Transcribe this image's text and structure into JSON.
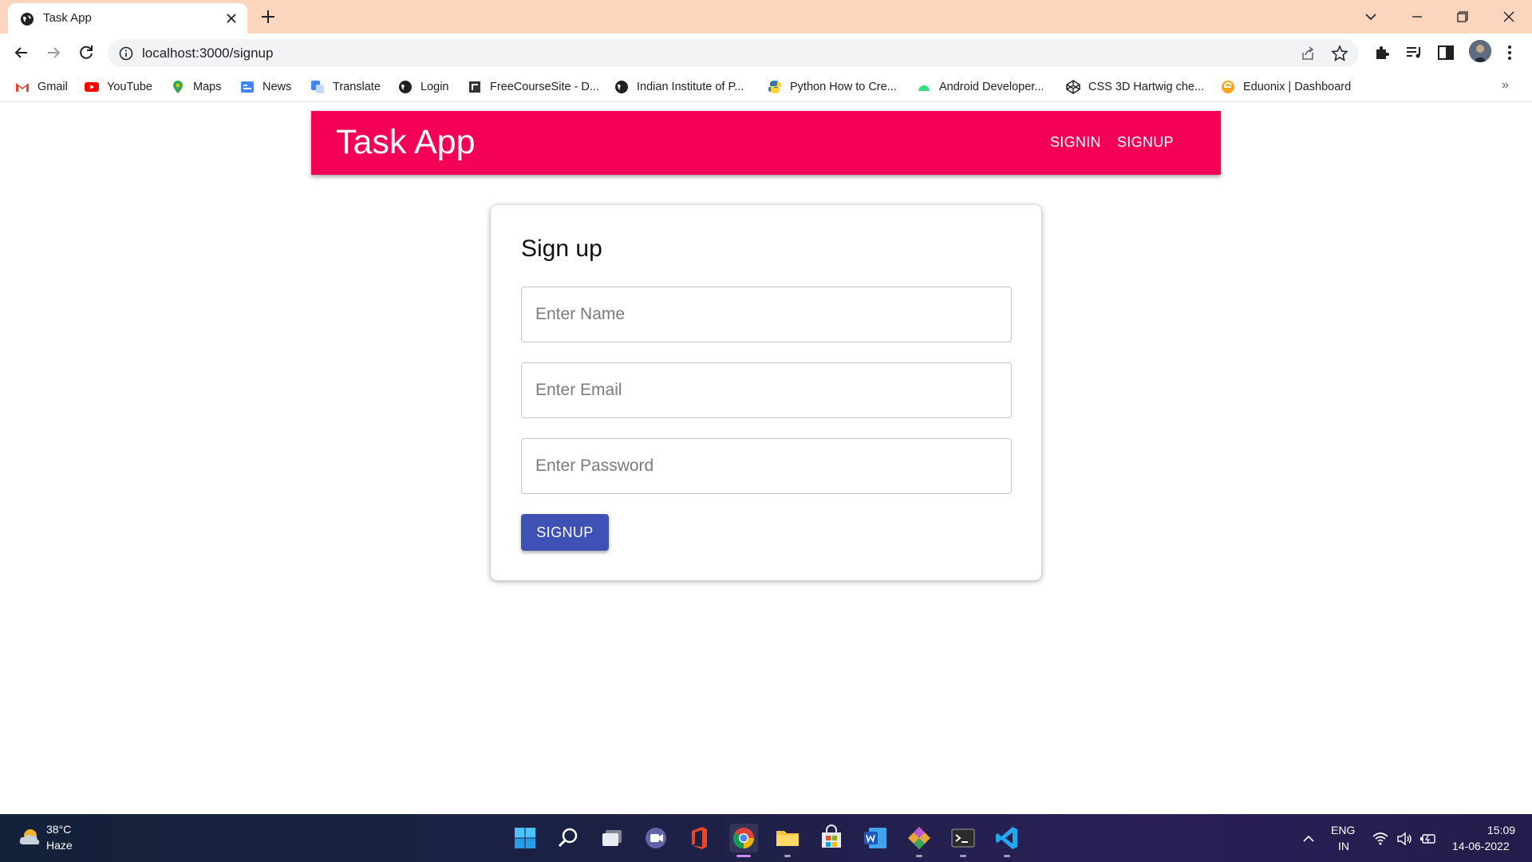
{
  "browser": {
    "tab_title": "Task App",
    "url": "localhost:3000/signup",
    "bookmarks": [
      {
        "label": "Gmail",
        "icon": "gmail-icon"
      },
      {
        "label": "YouTube",
        "icon": "youtube-icon"
      },
      {
        "label": "Maps",
        "icon": "maps-icon"
      },
      {
        "label": "News",
        "icon": "news-icon"
      },
      {
        "label": "Translate",
        "icon": "translate-icon"
      },
      {
        "label": "Login",
        "icon": "globe-icon"
      },
      {
        "label": "FreeCourseSite - D...",
        "icon": "site-icon"
      },
      {
        "label": "Indian Institute of P...",
        "icon": "globe-icon"
      },
      {
        "label": "Python How to Cre...",
        "icon": "python-icon"
      },
      {
        "label": "Android Developer...",
        "icon": "android-icon"
      },
      {
        "label": "CSS 3D Hartwig che...",
        "icon": "codepen-icon"
      },
      {
        "label": "Eduonix | Dashboard",
        "icon": "eduonix-icon"
      }
    ],
    "more_bookmarks": "»"
  },
  "app": {
    "title": "Task App",
    "nav": {
      "signin": "SIGNIN",
      "signup": "SIGNUP"
    },
    "accent": "#f50057"
  },
  "form": {
    "heading": "Sign up",
    "name_placeholder": "Enter Name",
    "email_placeholder": "Enter Email",
    "password_placeholder": "Enter Password",
    "submit_label": "SIGNUP",
    "button_color": "#3f51b5"
  },
  "taskbar": {
    "weather_temp": "38°C",
    "weather_desc": "Haze",
    "lang_top": "ENG",
    "lang_bottom": "IN",
    "time": "15:09",
    "date": "14-06-2022",
    "apps": [
      "start-icon",
      "search-icon",
      "task-view-icon",
      "teams-icon",
      "office-icon",
      "chrome-icon",
      "file-explorer-icon",
      "store-icon",
      "word-icon",
      "git-icon",
      "terminal-icon",
      "vscode-icon"
    ]
  }
}
